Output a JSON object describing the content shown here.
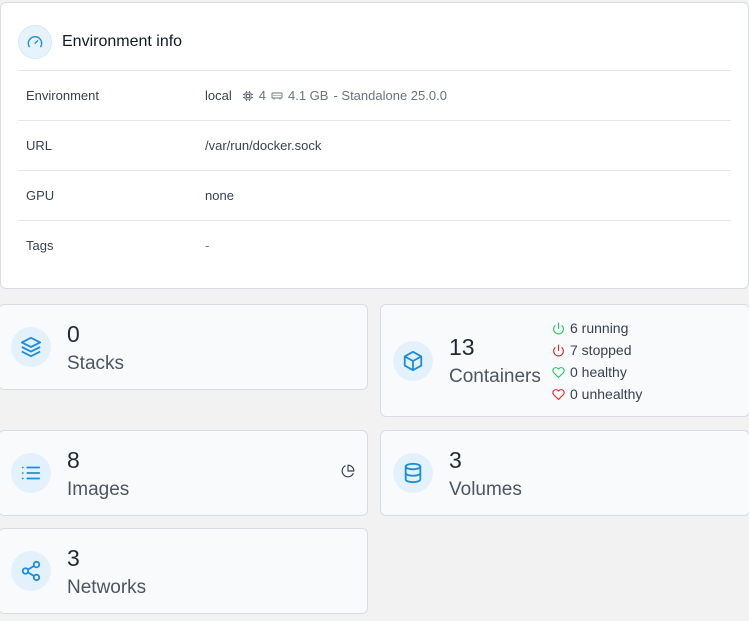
{
  "env_info": {
    "title": "Environment info",
    "rows": {
      "environment": {
        "label": "Environment",
        "name": "local",
        "cpu": "4",
        "memory": "4.1 GB",
        "suffix": "- Standalone 25.0.0"
      },
      "url": {
        "label": "URL",
        "value": "/var/run/docker.sock"
      },
      "gpu": {
        "label": "GPU",
        "value": "none"
      },
      "tags": {
        "label": "Tags",
        "value": "-"
      }
    }
  },
  "stats": {
    "stacks": {
      "value": "0",
      "label": "Stacks",
      "icon": "layers-icon"
    },
    "containers": {
      "value": "13",
      "label": "Containers",
      "icon": "cube-icon",
      "running": "6 running",
      "stopped": "7 stopped",
      "healthy": "0 healthy",
      "unhealthy": "0 unhealthy"
    },
    "images": {
      "value": "8",
      "label": "Images",
      "icon": "list-icon"
    },
    "volumes": {
      "value": "3",
      "label": "Volumes",
      "icon": "database-icon"
    },
    "networks": {
      "value": "3",
      "label": "Networks",
      "icon": "share-icon"
    }
  },
  "colors": {
    "accent": "#1f8dd6",
    "running": "#22c55e",
    "stopped": "#dc2626",
    "healthy": "#22c55e",
    "unhealthy": "#dc2626"
  }
}
